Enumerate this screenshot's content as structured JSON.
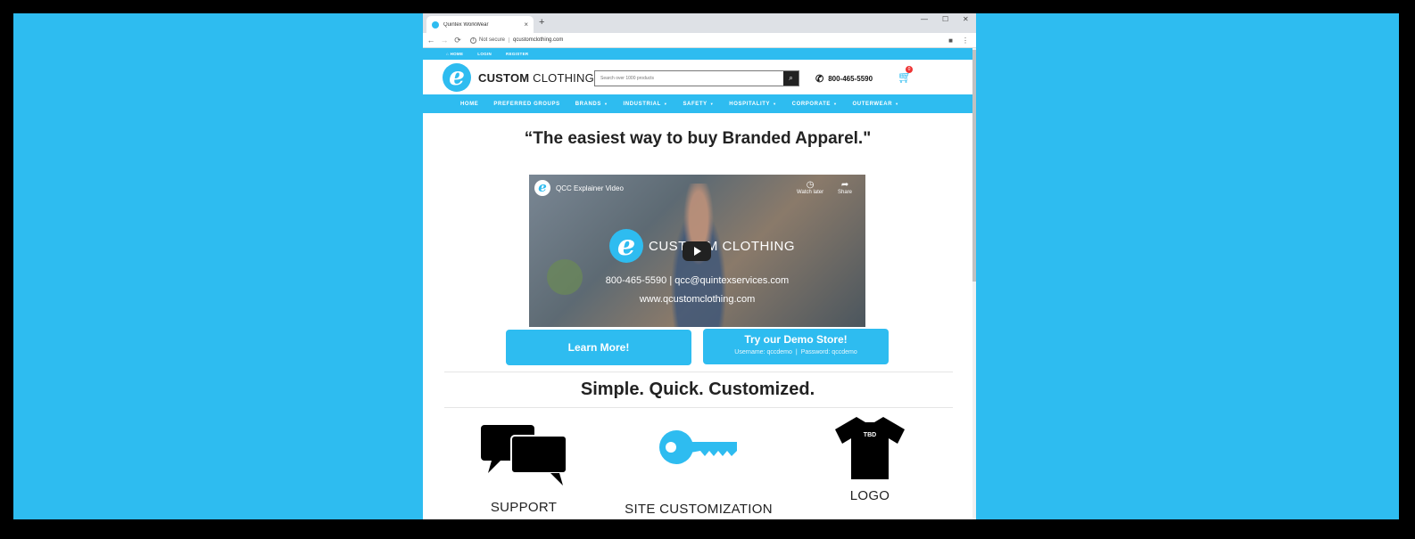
{
  "browser": {
    "tab_title": "Quintex WorkWear",
    "tab_close": "×",
    "new_tab": "+",
    "minimize": "—",
    "maximize": "☐",
    "close": "✕",
    "security_label": "Not secure",
    "url": "qcustomclothing.com"
  },
  "site": {
    "top_links": [
      "HOME",
      "LOGIN",
      "REGISTER"
    ],
    "logo": {
      "mark": "e",
      "bold": "CUSTOM",
      "rest": "CLOTHING"
    },
    "search": {
      "placeholder": "Search over 1000 products"
    },
    "phone": "800-465-5590",
    "cart_count": "0",
    "nav": [
      {
        "label": "HOME",
        "dropdown": false
      },
      {
        "label": "PREFERRED GROUPS",
        "dropdown": false
      },
      {
        "label": "BRANDS",
        "dropdown": true
      },
      {
        "label": "INDUSTRIAL",
        "dropdown": true
      },
      {
        "label": "SAFETY",
        "dropdown": true
      },
      {
        "label": "HOSPITALITY",
        "dropdown": true
      },
      {
        "label": "CORPORATE",
        "dropdown": true
      },
      {
        "label": "OUTERWEAR",
        "dropdown": true
      }
    ],
    "headline": "“The easiest way to buy Branded Apparel.\"",
    "video": {
      "title": "QCC Explainer Video",
      "watch_later": "Watch later",
      "share": "Share",
      "brand_a": "CUST",
      "brand_b": "M CLOTHING",
      "contact": "800-465-5590 | qcc@quintexservices.com",
      "website": "www.qcustomclothing.com"
    },
    "learn_more": "Learn More!",
    "demo": {
      "label": "Try our Demo Store!",
      "username": "Username: qccdemo",
      "separator": "|",
      "password": "Password: qccdemo"
    },
    "subheadline": "Simple. Quick. Customized.",
    "features": [
      {
        "icon": "chat-bubbles-icon",
        "caption": "SUPPORT"
      },
      {
        "icon": "key-icon",
        "caption": "SITE CUSTOMIZATION"
      },
      {
        "icon": "tshirt-icon",
        "caption": "LOGO",
        "shirt_text": "TBD"
      }
    ]
  },
  "colors": {
    "accent": "#2ebcf0",
    "background": "#2ebcf0",
    "frame": "#000000"
  }
}
